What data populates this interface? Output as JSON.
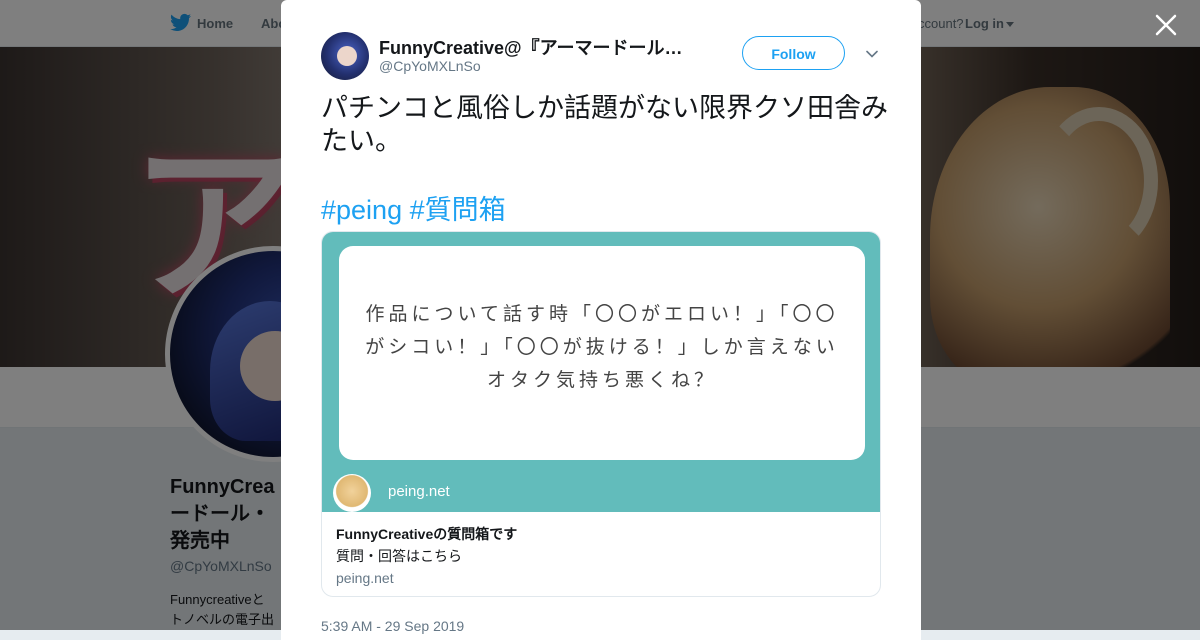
{
  "nav": {
    "home": "Home",
    "about": "Abo",
    "account": "ccount?",
    "login": "Log in"
  },
  "banner": {
    "text": "アー"
  },
  "profile": {
    "name": "FunnyCrea\nードール・\n発売中",
    "handle": "@CpYoMXLnSo",
    "bio": "Funnycreativeと\nトノベルの電子出"
  },
  "tweet": {
    "author_name": "FunnyCreative@『アーマードール…",
    "author_handle": "@CpYoMXLnSo",
    "follow_label": "Follow",
    "text": "パチンコと風俗しか話題がない限界クソ田舎みたい。",
    "hashtags": [
      "#peing",
      "#質問箱"
    ],
    "timestamp": "5:39 AM - 29 Sep 2019"
  },
  "card": {
    "question": "作品について話す時「〇〇がエロい！」「〇〇\nがシコい！」「〇〇が抜ける！」しか言えない\nオタク気持ち悪くね？",
    "site_label": "peing.net",
    "title": "FunnyCreativeの質問箱です",
    "description": "質問・回答はこちら",
    "domain": "peing.net"
  },
  "icons": {
    "twitter": "twitter-bird-icon",
    "close": "close-icon",
    "chevron": "chevron-down-icon",
    "peing": "peing-box-icon"
  },
  "colors": {
    "accent": "#1da1f2",
    "card_bg": "#62bcbb",
    "text": "#14171a",
    "muted": "#657786"
  }
}
